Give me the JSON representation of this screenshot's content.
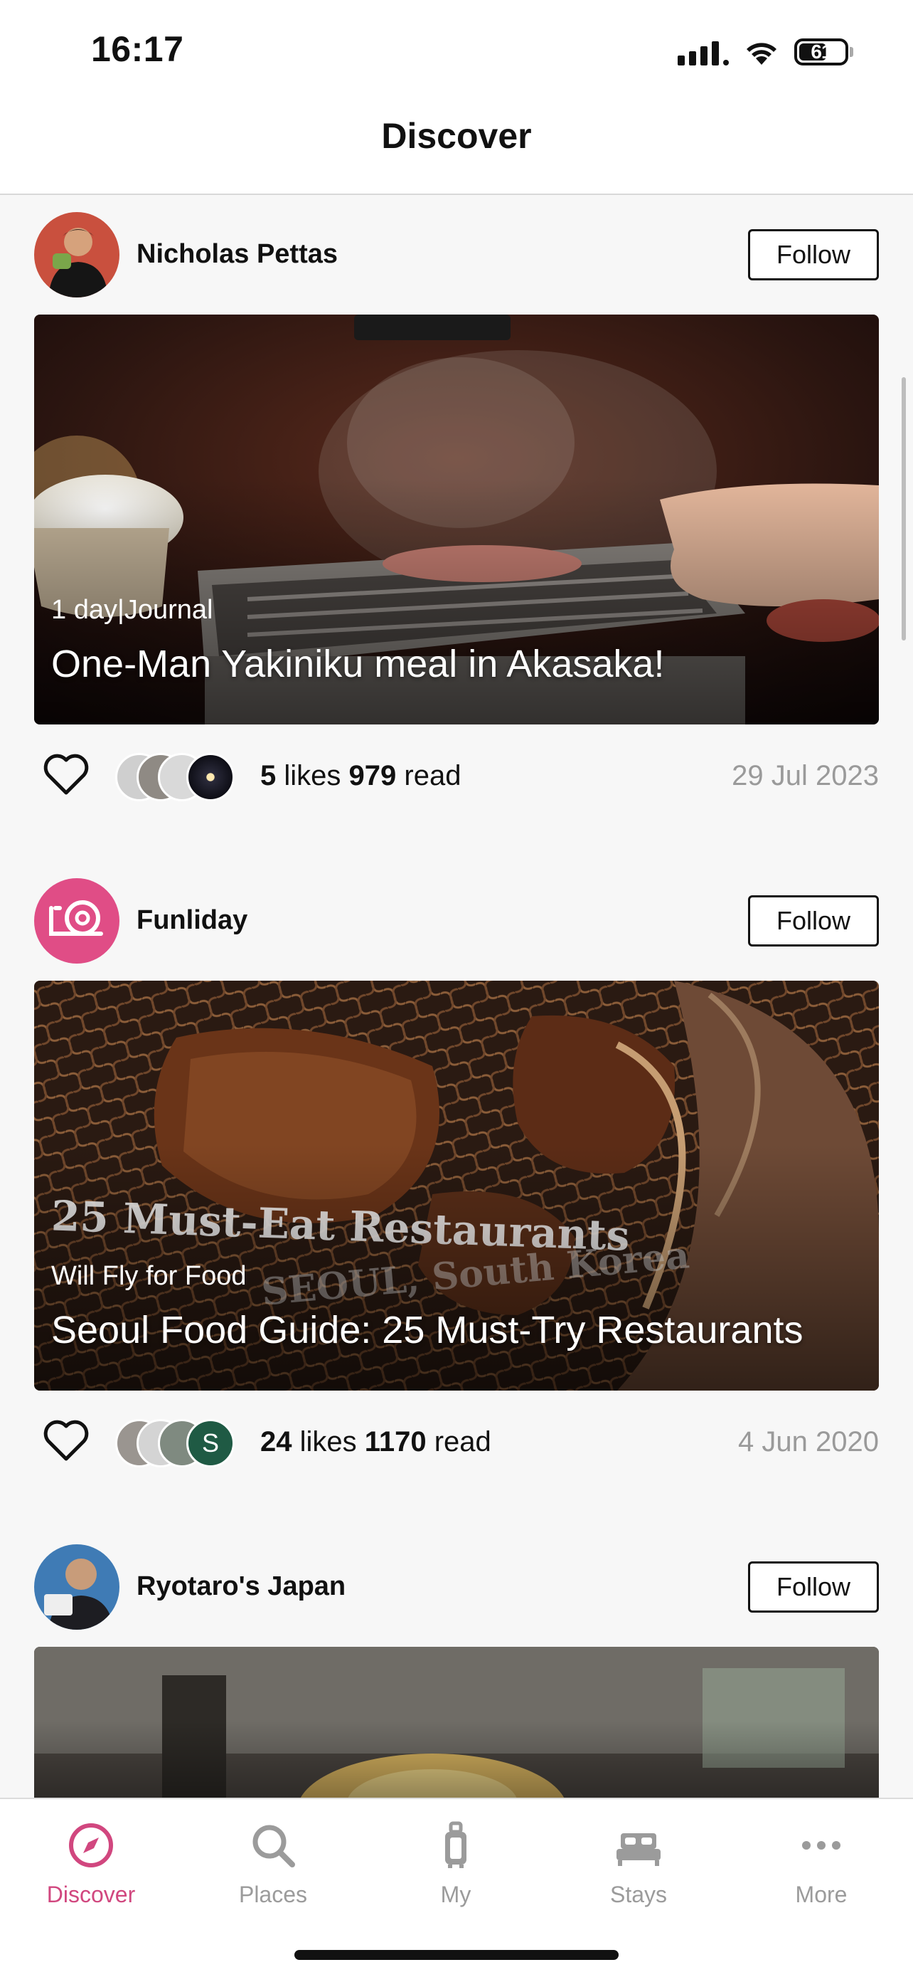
{
  "status_bar": {
    "time": "16:17",
    "battery": "61",
    "battery_level": 0.61
  },
  "header": {
    "title": "Discover"
  },
  "posts": [
    {
      "author": "Nicholas Pettas",
      "follow_label": "Follow",
      "meta": "1 day|Journal",
      "title": "One-Man Yakiniku meal in Akasaka!",
      "likes_count": "5",
      "likes_label": "likes",
      "reads_count": "979",
      "reads_label": "read",
      "date": "29 Jul 2023"
    },
    {
      "author": "Funliday",
      "follow_label": "Follow",
      "meta": "Will Fly for Food",
      "title": "Seoul Food Guide: 25 Must-Try Restaurants",
      "overlay_text": "25 Must-Eat Restaurants",
      "overlay_sub": "SEOUL, South Korea",
      "likes_count": "24",
      "likes_label": "likes",
      "reads_count": "1170",
      "reads_label": "read",
      "date": "4 Jun 2020",
      "liker_initial": "S"
    },
    {
      "author": "Ryotaro's Japan",
      "follow_label": "Follow"
    }
  ],
  "tabs": [
    {
      "label": "Discover",
      "icon": "compass-icon",
      "active": true
    },
    {
      "label": "Places",
      "icon": "search-icon",
      "active": false
    },
    {
      "label": "My",
      "icon": "luggage-icon",
      "active": false
    },
    {
      "label": "Stays",
      "icon": "bed-icon",
      "active": false
    },
    {
      "label": "More",
      "icon": "more-dots-icon",
      "active": false
    }
  ],
  "colors": {
    "accent": "#d1477f",
    "inactive": "#9b9b9b",
    "date": "#9a9a9a"
  }
}
